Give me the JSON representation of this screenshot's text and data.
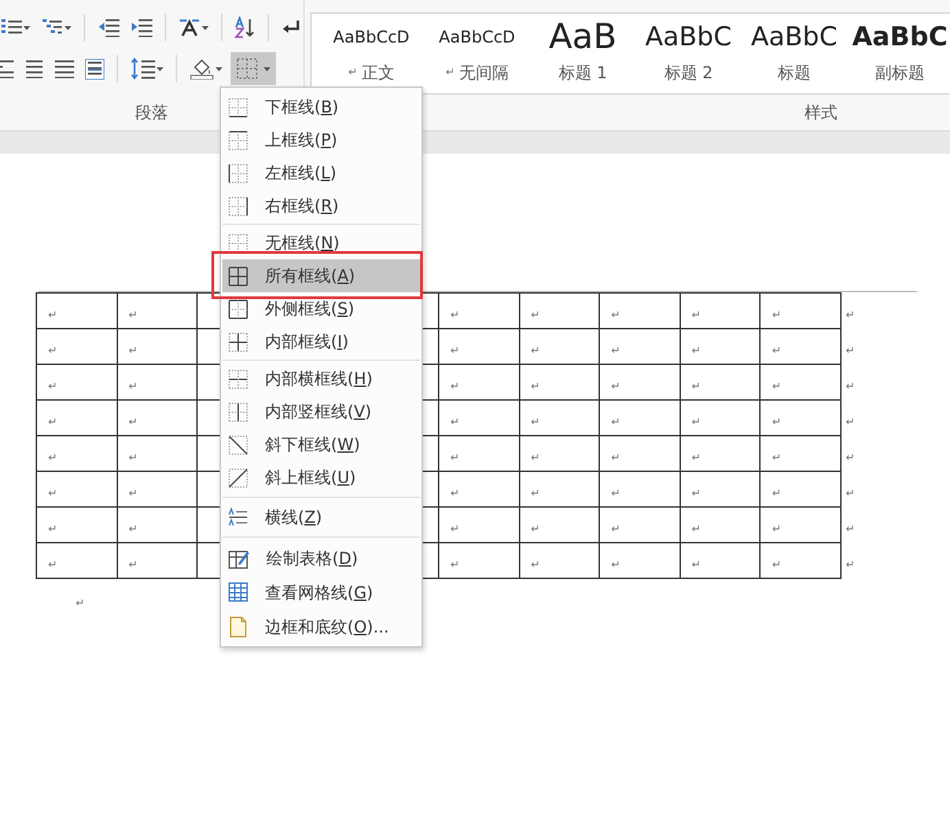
{
  "ribbon": {
    "paragraph_group": {
      "label": "段落",
      "border_button": {
        "pressed": true
      }
    },
    "styles_group": {
      "label": "样式",
      "styles": [
        {
          "kind": "body",
          "sample": "AaBbCcD",
          "para_mark": "↵",
          "name": "正文"
        },
        {
          "kind": "body",
          "sample": "AaBbCcD",
          "para_mark": "↵",
          "name": "无间隔"
        },
        {
          "kind": "heading1",
          "sample": "AaB",
          "name": "标题 1"
        },
        {
          "kind": "heading2",
          "sample": "AaBbC",
          "name": "标题 2"
        },
        {
          "kind": "title",
          "sample": "AaBbC",
          "name": "标题"
        },
        {
          "kind": "subtitle",
          "sample": "AaBbC",
          "name": "副标题"
        }
      ]
    }
  },
  "border_menu": {
    "items": [
      {
        "kind": "bottom",
        "before": "下框线(",
        "accelerator": "B",
        "after": ")",
        "selected": false,
        "callout": false,
        "separator_before": false
      },
      {
        "kind": "top",
        "before": "上框线(",
        "accelerator": "P",
        "after": ")",
        "selected": false,
        "callout": false,
        "separator_before": false
      },
      {
        "kind": "left",
        "before": "左框线(",
        "accelerator": "L",
        "after": ")",
        "selected": false,
        "callout": false,
        "separator_before": false
      },
      {
        "kind": "right",
        "before": "右框线(",
        "accelerator": "R",
        "after": ")",
        "selected": false,
        "callout": false,
        "separator_before": false
      },
      {
        "kind": "none",
        "before": "无框线(",
        "accelerator": "N",
        "after": ")",
        "selected": false,
        "callout": false,
        "separator_before": true
      },
      {
        "kind": "all",
        "before": "所有框线(",
        "accelerator": "A",
        "after": ")",
        "selected": true,
        "callout": true,
        "separator_before": false
      },
      {
        "kind": "outside",
        "before": "外侧框线(",
        "accelerator": "S",
        "after": ")",
        "selected": false,
        "callout": false,
        "separator_before": false
      },
      {
        "kind": "inside",
        "before": "内部框线(",
        "accelerator": "I",
        "after": ")",
        "selected": false,
        "callout": false,
        "separator_before": false
      },
      {
        "kind": "inside_h",
        "before": "内部横框线(",
        "accelerator": "H",
        "after": ")",
        "selected": false,
        "callout": false,
        "separator_before": true
      },
      {
        "kind": "inside_v",
        "before": "内部竖框线(",
        "accelerator": "V",
        "after": ")",
        "selected": false,
        "callout": false,
        "separator_before": false
      },
      {
        "kind": "diag_down",
        "before": "斜下框线(",
        "accelerator": "W",
        "after": ")",
        "selected": false,
        "callout": false,
        "separator_before": false
      },
      {
        "kind": "diag_up",
        "before": "斜上框线(",
        "accelerator": "U",
        "after": ")",
        "selected": false,
        "callout": false,
        "separator_before": false
      },
      {
        "kind": "hline",
        "before": "横线(",
        "accelerator": "Z",
        "after": ")",
        "selected": false,
        "callout": false,
        "separator_before": true
      },
      {
        "kind": "draw",
        "before": "绘制表格(",
        "accelerator": "D",
        "after": ")",
        "selected": false,
        "callout": false,
        "separator_before": true
      },
      {
        "kind": "gridlines",
        "before": "查看网格线(",
        "accelerator": "G",
        "after": ")",
        "selected": false,
        "callout": false,
        "separator_before": false
      },
      {
        "kind": "borders_shading",
        "before": "边框和底纹(",
        "accelerator": "O",
        "after": ")...",
        "selected": false,
        "callout": false,
        "separator_before": false
      }
    ]
  },
  "document": {
    "table": {
      "rows": [
        {
          "left_cells": [
            "↵",
            "↵"
          ],
          "right_cells": [
            "↵",
            "↵",
            "↵",
            "↵",
            "↵"
          ],
          "row_end": "↵"
        },
        {
          "left_cells": [
            "↵",
            "↵"
          ],
          "right_cells": [
            "↵",
            "↵",
            "↵",
            "↵",
            "↵"
          ],
          "row_end": "↵"
        },
        {
          "left_cells": [
            "↵",
            "↵"
          ],
          "right_cells": [
            "↵",
            "↵",
            "↵",
            "↵",
            "↵"
          ],
          "row_end": "↵"
        },
        {
          "left_cells": [
            "↵",
            "↵"
          ],
          "right_cells": [
            "↵",
            "↵",
            "↵",
            "↵",
            "↵"
          ],
          "row_end": "↵"
        },
        {
          "left_cells": [
            "↵",
            "↵"
          ],
          "right_cells": [
            "↵",
            "↵",
            "↵",
            "↵",
            "↵"
          ],
          "row_end": "↵"
        },
        {
          "left_cells": [
            "↵",
            "↵"
          ],
          "right_cells": [
            "↵",
            "↵",
            "↵",
            "↵",
            "↵"
          ],
          "row_end": "↵"
        },
        {
          "left_cells": [
            "↵",
            "↵"
          ],
          "right_cells": [
            "↵",
            "↵",
            "↵",
            "↵",
            "↵"
          ],
          "row_end": "↵"
        },
        {
          "left_cells": [
            "↵",
            "↵"
          ],
          "right_cells": [
            "↵",
            "↵",
            "↵",
            "↵",
            "↵"
          ],
          "row_end": "↵"
        }
      ]
    },
    "after_table_mark": "↵"
  }
}
